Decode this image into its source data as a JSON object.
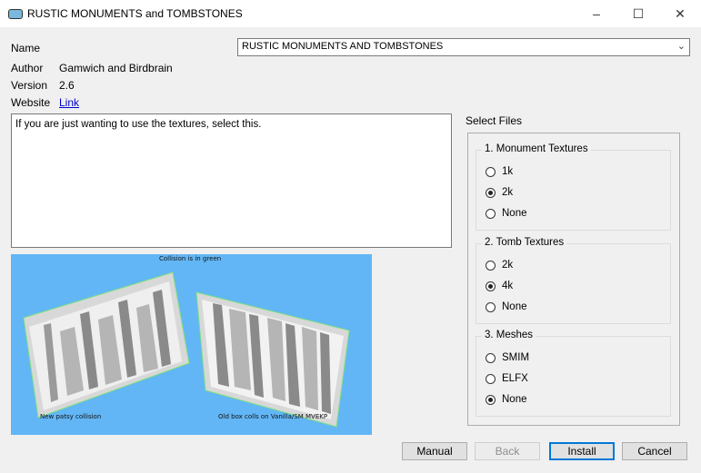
{
  "window": {
    "title": "RUSTIC MONUMENTS and TOMBSTONES",
    "controls": {
      "minimize": "–",
      "maximize": "☐",
      "close": "✕"
    }
  },
  "info": {
    "name_label": "Name",
    "name_value": "RUSTIC MONUMENTS AND TOMBSTONES",
    "author_label": "Author",
    "author_value": "Gamwich and Birdbrain",
    "version_label": "Version",
    "version_value": "2.6",
    "website_label": "Website",
    "website_value": "Link"
  },
  "description": "If you are just wanting to use the textures, select this.",
  "preview": {
    "caption_top": "Collision is in green",
    "caption_left": "New patsy collision",
    "caption_right": "Old box colls on Vanilla/SM MVEKP"
  },
  "select_files": {
    "title": "Select Files",
    "groups": [
      {
        "title": "1. Monument Textures",
        "options": [
          {
            "label": "1k",
            "selected": false
          },
          {
            "label": "2k",
            "selected": true
          },
          {
            "label": "None",
            "selected": false
          }
        ]
      },
      {
        "title": "2. Tomb Textures",
        "options": [
          {
            "label": "2k",
            "selected": false
          },
          {
            "label": "4k",
            "selected": true
          },
          {
            "label": "None",
            "selected": false
          }
        ]
      },
      {
        "title": "3. Meshes",
        "options": [
          {
            "label": "SMIM",
            "selected": false
          },
          {
            "label": "ELFX",
            "selected": false
          },
          {
            "label": "None",
            "selected": true
          }
        ]
      }
    ]
  },
  "buttons": {
    "manual": "Manual",
    "back": "Back",
    "install": "Install",
    "cancel": "Cancel"
  },
  "colors": {
    "preview_bg": "#62b6f5",
    "accent": "#0078d7"
  }
}
